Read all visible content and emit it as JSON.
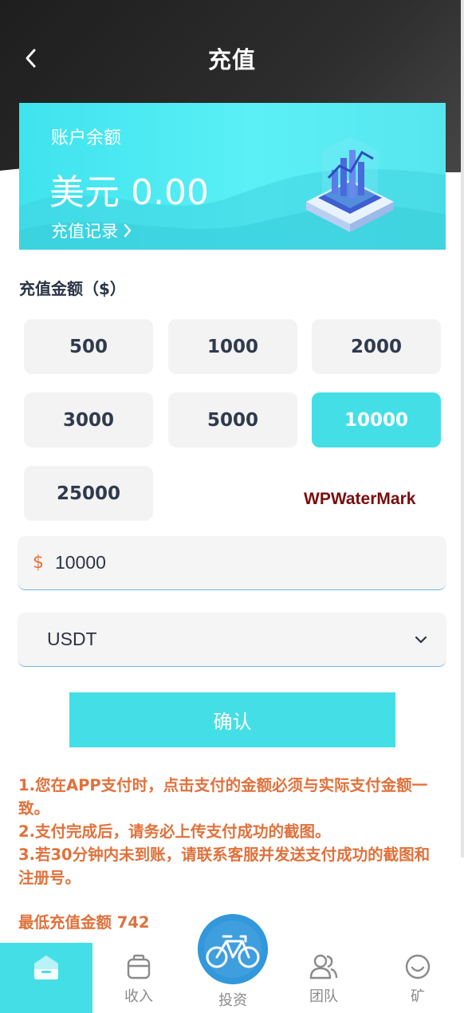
{
  "header": {
    "title": "充值",
    "back_icon": "chevron-left-icon"
  },
  "balance_card": {
    "label": "账户余额",
    "amount": "美元 0.00",
    "records_link": "充值记录",
    "records_icon": "chevron-right-icon"
  },
  "amount_section": {
    "label": "充值金额（$）",
    "options": [
      "500",
      "1000",
      "2000",
      "3000",
      "5000",
      "10000",
      "25000"
    ],
    "selected": "10000"
  },
  "watermark": "WPWaterMark",
  "amount_input": {
    "prefix": "$",
    "value": "10000"
  },
  "currency_select": {
    "value": "USDT",
    "icon": "chevron-down-icon"
  },
  "confirm_button": "确认",
  "notes": [
    "1.您在APP支付时，点击支付的金额必须与实际支付金额一致。",
    "2.支付完成后，请务必上传支付成功的截图。",
    "3.若30分钟内未到账，请联系客服并发送支付成功的截图和注册号。"
  ],
  "min_amount": "最低充值金额 742",
  "tabbar": {
    "items": [
      {
        "label": "",
        "icon": "home-icon",
        "active": true
      },
      {
        "label": "收入",
        "icon": "bag-icon",
        "active": false
      },
      {
        "label": "投资",
        "icon": "bike-icon",
        "active": false
      },
      {
        "label": "团队",
        "icon": "team-icon",
        "active": false
      },
      {
        "label": "矿",
        "icon": "smile-icon",
        "active": false
      }
    ]
  },
  "colors": {
    "accent": "#44dfe6",
    "notice": "#e0713b",
    "header_dark": "#2a2a2a",
    "watermark": "#7a0d0d"
  }
}
